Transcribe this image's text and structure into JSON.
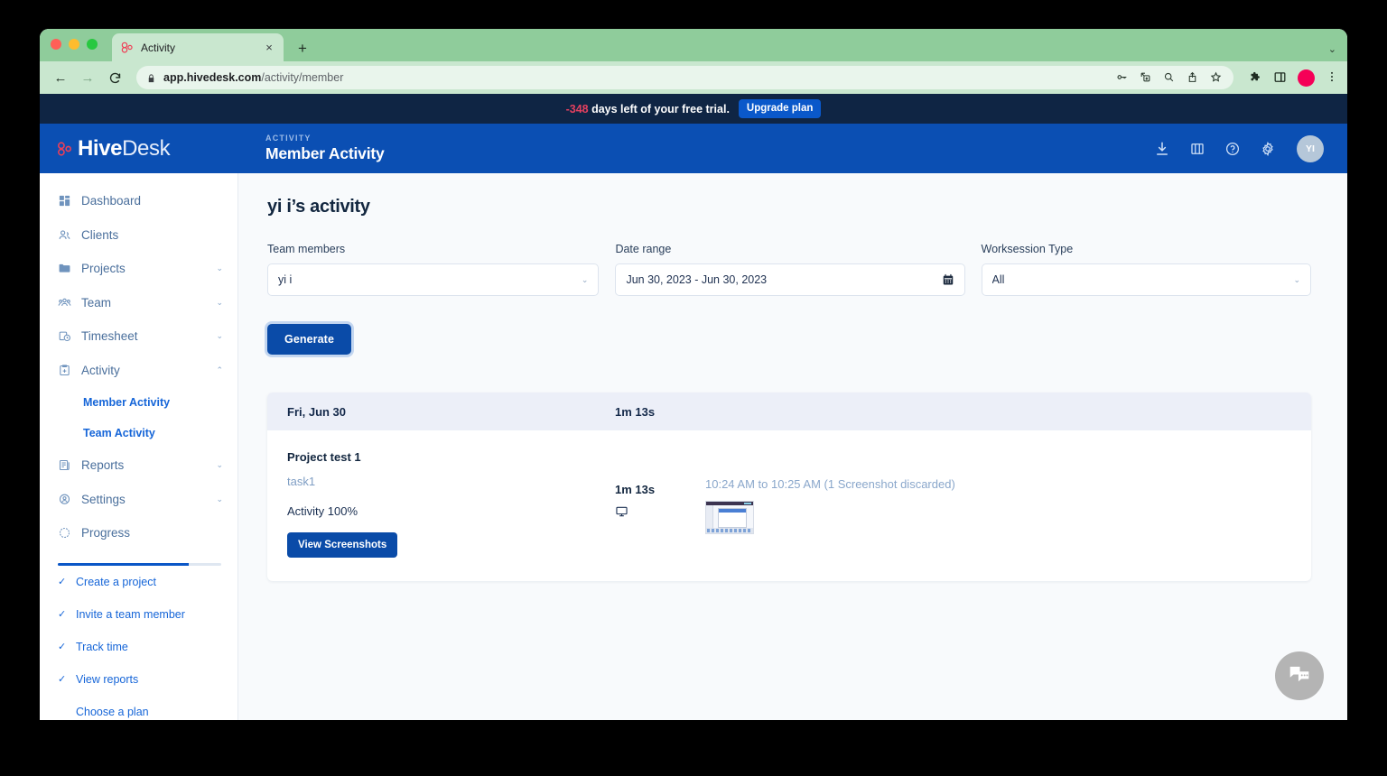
{
  "browser": {
    "tab": {
      "title": "Activity",
      "favicon": "hivedesk-logo-icon",
      "close_label": "×"
    },
    "new_tab_label": "+",
    "tabstrip_collapse_label": "⌄",
    "nav": {
      "back": "←",
      "forward": "→",
      "reload": "C"
    },
    "url_secure_part": "app.hivedesk.com",
    "url_path": "/activity/member",
    "omnibox_icons": [
      "key-icon",
      "install-app-icon",
      "zoom-icon",
      "share-icon",
      "bookmark-star-icon"
    ],
    "toolbar_icons": [
      "extensions-puzzle-icon",
      "side-panel-icon",
      "profile-avatar-icon",
      "chrome-menu-icon"
    ]
  },
  "banner": {
    "days": "-348",
    "message": "days left of your free trial.",
    "upgrade_label": "Upgrade plan"
  },
  "header": {
    "logo_primary": "Hive",
    "logo_secondary": "Desk",
    "eyebrow": "ACTIVITY",
    "title": "Member Activity",
    "icons": [
      "download-icon",
      "book-icon",
      "help-icon",
      "settings-gear-icon"
    ],
    "avatar_initials": "YI"
  },
  "sidebar": {
    "items": [
      {
        "label": "Dashboard",
        "icon": "dashboard-icon",
        "expandable": false
      },
      {
        "label": "Clients",
        "icon": "clients-icon",
        "expandable": false
      },
      {
        "label": "Projects",
        "icon": "folder-icon",
        "expandable": true,
        "caret": "⌄"
      },
      {
        "label": "Team",
        "icon": "team-icon",
        "expandable": true,
        "caret": "⌄"
      },
      {
        "label": "Timesheet",
        "icon": "timesheet-clock-icon",
        "expandable": true,
        "caret": "⌄"
      },
      {
        "label": "Activity",
        "icon": "activity-icon",
        "expandable": true,
        "caret": "⌃",
        "expanded": true
      },
      {
        "label": "Reports",
        "icon": "reports-icon",
        "expandable": true,
        "caret": "⌄"
      },
      {
        "label": "Settings",
        "icon": "settings-shield-icon",
        "expandable": true,
        "caret": "⌄"
      },
      {
        "label": "Progress",
        "icon": "progress-clock-icon",
        "expandable": false
      }
    ],
    "activity_subitems": [
      {
        "label": "Member Activity"
      },
      {
        "label": "Team Activity"
      }
    ],
    "progress_percent": 80,
    "checklist": [
      {
        "label": "Create a project",
        "done": true,
        "check": "✓"
      },
      {
        "label": "Invite a team member",
        "done": true,
        "check": "✓"
      },
      {
        "label": "Track time",
        "done": true,
        "check": "✓"
      },
      {
        "label": "View reports",
        "done": true,
        "check": "✓"
      },
      {
        "label": "Choose a plan",
        "done": false,
        "check": ""
      }
    ]
  },
  "main": {
    "page_title": "yi i’s activity",
    "filters": {
      "team_members": {
        "label": "Team members",
        "value": "yi i",
        "chevron": "⌄"
      },
      "date_range": {
        "label": "Date range",
        "value": "Jun 30, 2023 - Jun 30, 2023",
        "icon": "calendar-icon"
      },
      "worksession_type": {
        "label": "Worksession Type",
        "value": "All",
        "chevron": "⌄"
      }
    },
    "generate_label": "Generate",
    "results": {
      "header": {
        "date": "Fri, Jun 30",
        "total_duration": "1m 13s"
      },
      "rows": [
        {
          "project": "Project test 1",
          "task": "task1",
          "activity": "Activity 100%",
          "view_screenshots_label": "View Screenshots",
          "duration": "1m 13s",
          "device_icon": "monitor-icon",
          "session_time": "10:24 AM to 10:25 AM (1 Screenshot discarded)",
          "thumbnail": "screenshot-thumbnail"
        }
      ]
    },
    "chat_widget_icon": "chat-bubbles-icon"
  },
  "colors": {
    "brand_blue": "#0b4fb3",
    "banner_navy": "#0f2544",
    "accent_red": "#e4405f",
    "button_blue": "#0a4ba8",
    "link_blue": "#1565d8",
    "browser_theme_green": "#8fcc9b"
  }
}
